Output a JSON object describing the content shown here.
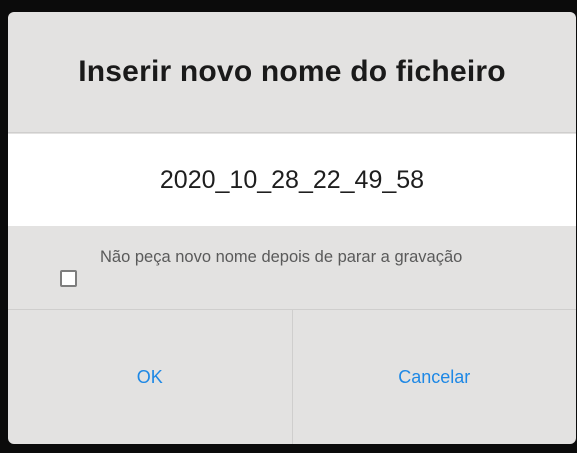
{
  "dialog": {
    "title": "Inserir novo nome do ficheiro",
    "filename_value": "2020_10_28_22_49_58",
    "checkbox": {
      "checked": false,
      "label": "Não peça novo nome depois de parar a gravação"
    },
    "buttons": {
      "ok_label": "OK",
      "cancel_label": "Cancelar"
    }
  },
  "colors": {
    "dialog_bg": "#e3e2e1",
    "field_bg": "#ffffff",
    "button_text": "#1e88e5",
    "backdrop": "#0b0b0b"
  }
}
